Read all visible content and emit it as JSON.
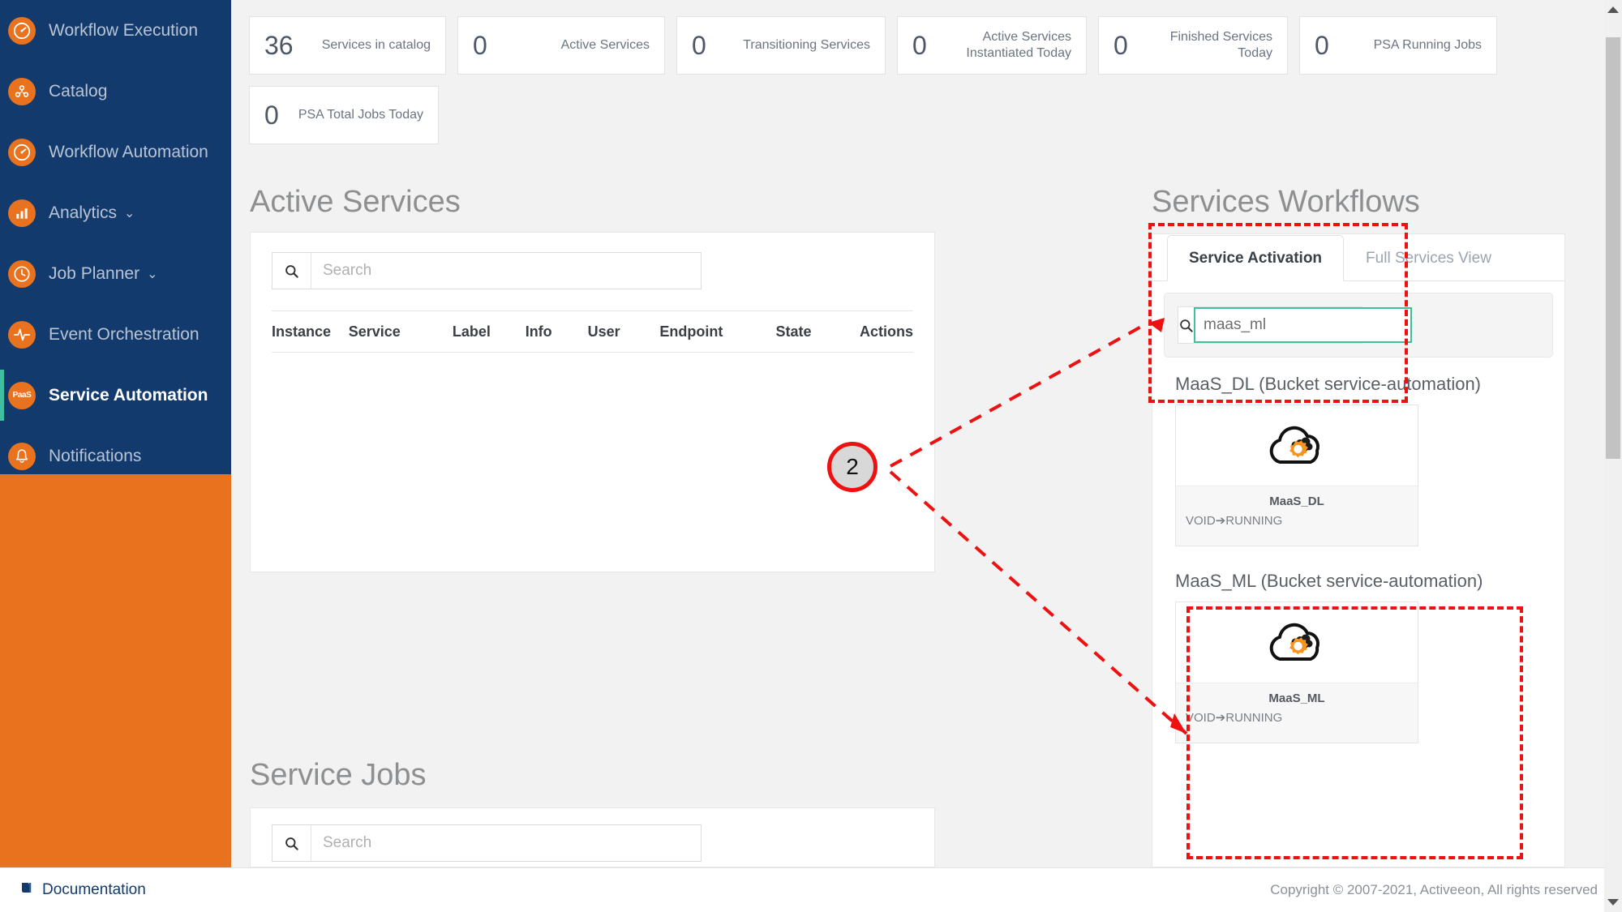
{
  "sidebar": {
    "items": [
      {
        "label": "Workflow Execution",
        "icon": "gauge-icon",
        "active": false,
        "caret": ""
      },
      {
        "label": "Catalog",
        "icon": "catalog-icon",
        "active": false,
        "caret": ""
      },
      {
        "label": "Workflow Automation",
        "icon": "gauge-icon",
        "active": false,
        "caret": ""
      },
      {
        "label": "Analytics",
        "icon": "bar-chart-icon",
        "active": false,
        "caret": "⌄"
      },
      {
        "label": "Job Planner",
        "icon": "clock-icon",
        "active": false,
        "caret": "⌄"
      },
      {
        "label": "Event Orchestration",
        "icon": "pulse-icon",
        "active": false,
        "caret": ""
      },
      {
        "label": "Service Automation",
        "icon": "paas-icon",
        "active": true,
        "caret": ""
      },
      {
        "label": "Notifications",
        "icon": "bell-icon",
        "active": false,
        "caret": ""
      }
    ]
  },
  "stats": [
    {
      "value": "36",
      "label": "Services in catalog"
    },
    {
      "value": "0",
      "label": "Active Services"
    },
    {
      "value": "0",
      "label": "Transitioning Services"
    },
    {
      "value": "0",
      "label": "Active Services Instantiated Today"
    },
    {
      "value": "0",
      "label": "Finished Services Today"
    },
    {
      "value": "0",
      "label": "PSA Running Jobs"
    },
    {
      "value": "0",
      "label": "PSA Total Jobs Today"
    }
  ],
  "active_services": {
    "title": "Active Services",
    "search_placeholder": "Search",
    "search_value": "",
    "columns": [
      "Instance",
      "Service",
      "Label",
      "Info",
      "User",
      "Endpoint",
      "State",
      "Actions"
    ],
    "rows": []
  },
  "service_jobs": {
    "title": "Service Jobs",
    "search_placeholder": "Search",
    "search_value": ""
  },
  "services_workflows": {
    "title": "Services Workflows",
    "tabs": [
      {
        "label": "Service Activation",
        "active": true
      },
      {
        "label": "Full Services View",
        "active": false
      }
    ],
    "search_placeholder": "",
    "search_value": "maas_ml",
    "groups": [
      {
        "title": "MaaS_DL (Bucket service-automation)",
        "cards": [
          {
            "name": "MaaS_DL",
            "state": "VOID➔RUNNING",
            "icon": "cloud-gear-icon"
          }
        ]
      },
      {
        "title": "MaaS_ML (Bucket service-automation)",
        "cards": [
          {
            "name": "MaaS_ML",
            "state": "VOID➔RUNNING",
            "icon": "cloud-gear-icon"
          }
        ]
      }
    ]
  },
  "footer": {
    "documentation": "Documentation",
    "copyright": "Copyright © 2007-2021, Activeeon, All rights reserved"
  },
  "annotation": {
    "step_number": "2",
    "color": "#ee1111"
  },
  "colors": {
    "sidebar_navy": "#123a6d",
    "brand_orange": "#e8721e",
    "accent_teal": "#3fbf9b",
    "annotation_red": "#ee1111"
  }
}
